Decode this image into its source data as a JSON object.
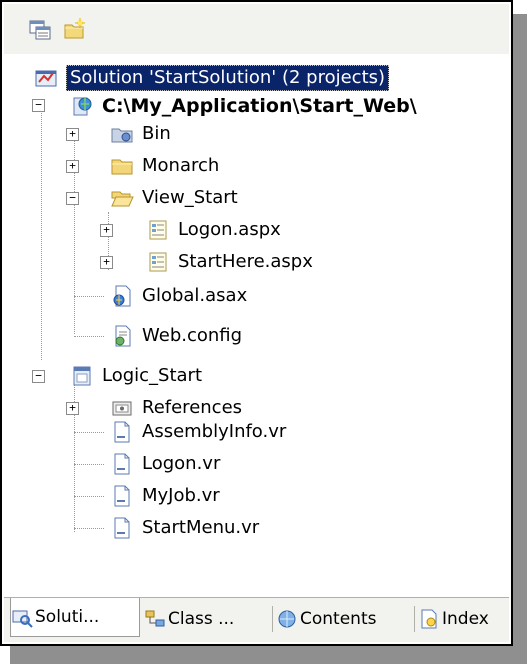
{
  "toolbar": {
    "icons": [
      "properties-icon",
      "show-all-files-icon"
    ]
  },
  "tree": {
    "solution": "Solution 'StartSolution' (2 projects)",
    "web_project": "C:\\My_Application\\Start_Web\\",
    "bin": "Bin",
    "monarch": "Monarch",
    "view_start": "View_Start",
    "logon_aspx": "Logon.aspx",
    "starthere_aspx": "StartHere.aspx",
    "global_asax": "Global.asax",
    "web_config": "Web.config",
    "logic_project": "Logic_Start",
    "references": "References",
    "assemblyinfo": "AssemblyInfo.vr",
    "logon_vr": "Logon.vr",
    "myjob_vr": "MyJob.vr",
    "startmenu_vr": "StartMenu.vr"
  },
  "tabs": {
    "solution": "Soluti...",
    "class": "Class ...",
    "contents": "Contents",
    "index": "Index"
  },
  "colors": {
    "selection": "#0a246a",
    "toolbar_bg": "#f2f2ee"
  }
}
